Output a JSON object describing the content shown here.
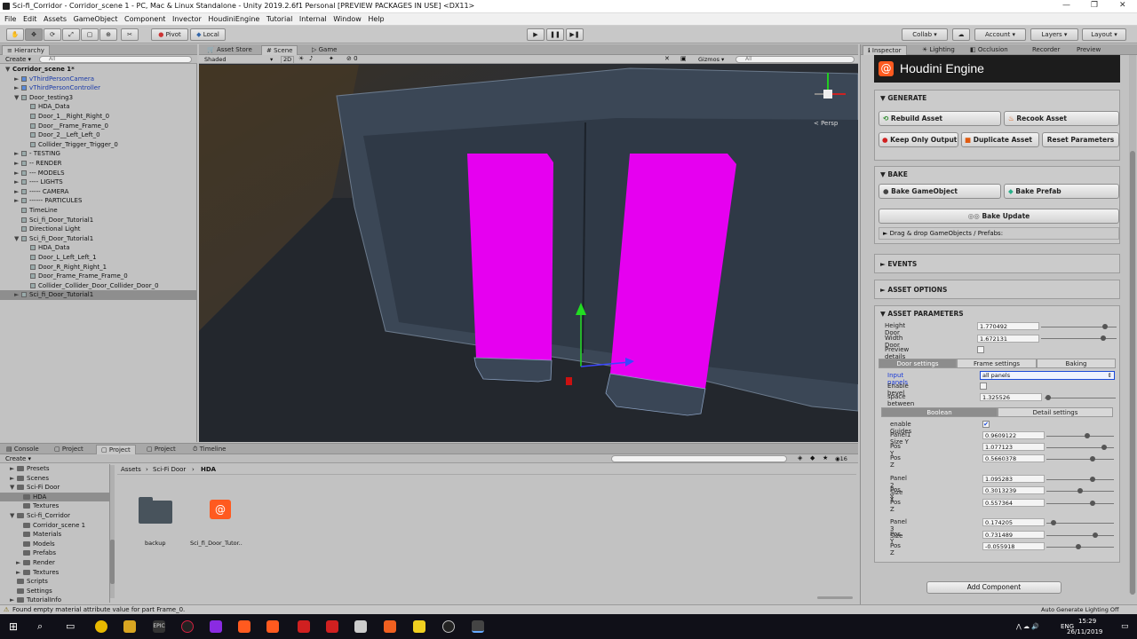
{
  "window": {
    "title": "Sci-fi_Corridor - Corridor_scene 1 - PC, Mac & Linux Standalone - Unity 2019.2.6f1 Personal [PREVIEW PACKAGES IN USE] <DX11>"
  },
  "menu": [
    "File",
    "Edit",
    "Assets",
    "GameObject",
    "Component",
    "Invector",
    "HoudiniEngine",
    "Tutorial",
    "Internal",
    "Window",
    "Help"
  ],
  "toolbar": {
    "pivot": "Pivot",
    "local": "Local",
    "collab": "Collab",
    "account": "Account",
    "layers": "Layers",
    "layout": "Layout"
  },
  "hierarchy": {
    "tab": "Hierarchy",
    "create": "Create",
    "search_placeholder": "All",
    "rows": [
      {
        "label": "Corridor_scene 1*",
        "indent": 0,
        "bold": true,
        "arrow": "▼"
      },
      {
        "label": "vThirdPersonCamera",
        "indent": 1,
        "blue": true,
        "arrow": "►"
      },
      {
        "label": "vThirdPersonController",
        "indent": 1,
        "blue": true,
        "arrow": "►"
      },
      {
        "label": "Door_testing3",
        "indent": 1,
        "arrow": "▼"
      },
      {
        "label": "HDA_Data",
        "indent": 2,
        "arrow": ""
      },
      {
        "label": "Door_1__Right_Right_0",
        "indent": 2,
        "arrow": ""
      },
      {
        "label": "Door__Frame_Frame_0",
        "indent": 2,
        "arrow": ""
      },
      {
        "label": "Door_2__Left_Left_0",
        "indent": 2,
        "arrow": ""
      },
      {
        "label": "Collider_Trigger_Trigger_0",
        "indent": 2,
        "arrow": ""
      },
      {
        "label": "- TESTING",
        "indent": 1,
        "arrow": "►"
      },
      {
        "label": "-- RENDER",
        "indent": 1,
        "arrow": "►"
      },
      {
        "label": "--- MODELS",
        "indent": 1,
        "arrow": "►"
      },
      {
        "label": "---- LIGHTS",
        "indent": 1,
        "arrow": "►"
      },
      {
        "label": "----- CAMERA",
        "indent": 1,
        "arrow": "►"
      },
      {
        "label": "------ PARTICULES",
        "indent": 1,
        "arrow": "►"
      },
      {
        "label": "TimeLine",
        "indent": 1,
        "arrow": ""
      },
      {
        "label": "Sci_fi_Door_Tutorial1",
        "indent": 1,
        "arrow": ""
      },
      {
        "label": "Directional Light",
        "indent": 1,
        "arrow": ""
      },
      {
        "label": "Sci_fi_Door_Tutorial1",
        "indent": 1,
        "arrow": "▼"
      },
      {
        "label": "HDA_Data",
        "indent": 2,
        "arrow": ""
      },
      {
        "label": "Door_L_Left_Left_1",
        "indent": 2,
        "arrow": ""
      },
      {
        "label": "Door_R_Right_Right_1",
        "indent": 2,
        "arrow": ""
      },
      {
        "label": "Door_Frame_Frame_Frame_0",
        "indent": 2,
        "arrow": ""
      },
      {
        "label": "Collider_Collider_Door_Collider_Door_0",
        "indent": 2,
        "arrow": ""
      },
      {
        "label": "Sci_fi_Door_Tutorial1",
        "indent": 1,
        "arrow": "►",
        "selected": true
      }
    ]
  },
  "scene": {
    "tabs": [
      "Asset Store",
      "Scene",
      "Game"
    ],
    "shading": "Shaded",
    "mode2d": "2D",
    "gizmos": "Gizmos",
    "search_placeholder": "All",
    "persp": "< Persp",
    "fx_count": "0"
  },
  "project": {
    "tabs": [
      "Console",
      "Project",
      "Project",
      "Project",
      "Timeline"
    ],
    "create": "Create",
    "tree": [
      {
        "label": "Presets",
        "indent": 1,
        "arrow": "►"
      },
      {
        "label": "Scenes",
        "indent": 1,
        "arrow": "►"
      },
      {
        "label": "Sci-Fi Door",
        "indent": 1,
        "arrow": "▼"
      },
      {
        "label": "HDA",
        "indent": 2,
        "arrow": "",
        "selected": true
      },
      {
        "label": "Textures",
        "indent": 2,
        "arrow": ""
      },
      {
        "label": "Sci-fi_Corridor",
        "indent": 1,
        "arrow": "▼"
      },
      {
        "label": "Corridor_scene 1",
        "indent": 2,
        "arrow": ""
      },
      {
        "label": "Materials",
        "indent": 2,
        "arrow": ""
      },
      {
        "label": "Models",
        "indent": 2,
        "arrow": ""
      },
      {
        "label": "Prefabs",
        "indent": 2,
        "arrow": ""
      },
      {
        "label": "Render",
        "indent": 2,
        "arrow": "►"
      },
      {
        "label": "Textures",
        "indent": 2,
        "arrow": "►"
      },
      {
        "label": "Scripts",
        "indent": 1,
        "arrow": ""
      },
      {
        "label": "Settings",
        "indent": 1,
        "arrow": ""
      },
      {
        "label": "TutorialInfo",
        "indent": 1,
        "arrow": "►"
      }
    ],
    "breadcrumb": [
      "Assets",
      "Sci-Fi Door",
      "HDA"
    ],
    "assets": [
      {
        "label": "backup",
        "kind": "folder"
      },
      {
        "label": "Sci_fi_Door_Tutor..",
        "kind": "houdini"
      }
    ],
    "count": "16"
  },
  "inspector": {
    "tabs": [
      "Inspector",
      "Lighting",
      "Occlusion",
      "Recorder",
      "Preview"
    ],
    "title": "Houdini Engine",
    "generate": {
      "header": "GENERATE",
      "rebuild": "Rebuild Asset",
      "recook": "Recook Asset",
      "keep_output": "Keep Only Output",
      "duplicate": "Duplicate Asset",
      "reset": "Reset Parameters"
    },
    "bake": {
      "header": "BAKE",
      "bake_go": "Bake GameObject",
      "bake_prefab": "Bake Prefab",
      "bake_update": "Bake Update",
      "drag_drop": "Drag & drop GameObjects / Prefabs:"
    },
    "events": "EVENTS",
    "asset_options": "ASSET OPTIONS",
    "params": {
      "header": "ASSET PARAMETERS",
      "height_label": "Height Door",
      "height_value": "1.770492",
      "height_fraction": 0.85,
      "width_label": "Width Door",
      "width_value": "1.672131",
      "width_fraction": 0.82,
      "preview_label": "Preview details",
      "tabs": [
        "Door settings",
        "Frame settings",
        "Baking"
      ],
      "input_panels_label": "Input panels",
      "input_panels_value": "all panels",
      "enable_bevel_label": "Enable bevel",
      "space_label": "space between panels",
      "space_value": "1.325526",
      "space_fraction": 0.05,
      "subtabs": [
        "Boolean",
        "Detail settings"
      ],
      "guides_label": "enable Guides",
      "panels": [
        {
          "label": "Panel1 Size Y",
          "value": "0.9609122",
          "fraction": 0.6
        },
        {
          "label": "Pos Y",
          "value": "1.077123",
          "fraction": 0.85
        },
        {
          "label": "Pos Z",
          "value": "0.5660378",
          "fraction": 0.68
        },
        {
          "label": "Panel 2 Size Y",
          "value": "1.095283",
          "fraction": 0.68
        },
        {
          "label": "Pos Y",
          "value": "0.3013239",
          "fraction": 0.5
        },
        {
          "label": "Pos Z",
          "value": "0.557364",
          "fraction": 0.68
        },
        {
          "label": "Panel 3 Size",
          "value": "0.174205",
          "fraction": 0.1
        },
        {
          "label": "Pos Y",
          "value": "0.731489",
          "fraction": 0.73
        },
        {
          "label": "Pos Z",
          "value": "-0.055918",
          "fraction": 0.48
        }
      ]
    },
    "add_component": "Add Component"
  },
  "status": {
    "message": "Found empty material attribute value for part Frame_0.",
    "right": "Auto Generate Lighting Off"
  },
  "taskbar": {
    "lang": "ENG",
    "time": "15:29",
    "date": "26/11/2019"
  }
}
